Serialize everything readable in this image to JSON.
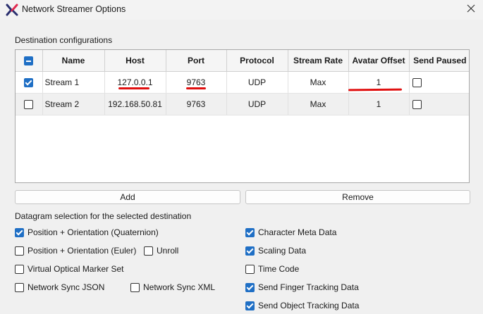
{
  "window": {
    "title": "Network Streamer Options",
    "icon": "x-logo-icon",
    "close_icon": "close-icon"
  },
  "destinations": {
    "label": "Destination configurations",
    "select_all_state": "partial",
    "columns": [
      "Name",
      "Host",
      "Port",
      "Protocol",
      "Stream Rate",
      "Avatar Offset",
      "Send Paused"
    ],
    "rows": [
      {
        "selected": true,
        "name": "Stream 1",
        "host": "127.0.0.1",
        "port": "9763",
        "protocol": "UDP",
        "rate": "Max",
        "offset": "1",
        "send_paused": false
      },
      {
        "selected": false,
        "name": "Stream 2",
        "host": "192.168.50.81",
        "port": "9763",
        "protocol": "UDP",
        "rate": "Max",
        "offset": "1",
        "send_paused": false
      }
    ]
  },
  "buttons": {
    "add": "Add",
    "remove": "Remove"
  },
  "datagram": {
    "label": "Datagram selection for the selected destination",
    "options": {
      "pos_quat": {
        "label": "Position + Orientation (Quaternion)",
        "checked": true
      },
      "pos_euler": {
        "label": "Position + Orientation (Euler)",
        "checked": false
      },
      "unroll": {
        "label": "Unroll",
        "checked": false
      },
      "virtual_marker": {
        "label": "Virtual Optical Marker Set",
        "checked": false
      },
      "sync_json": {
        "label": "Network Sync JSON",
        "checked": false
      },
      "sync_xml": {
        "label": "Network Sync XML",
        "checked": false
      },
      "char_meta": {
        "label": "Character Meta Data",
        "checked": true
      },
      "scaling": {
        "label": "Scaling Data",
        "checked": true
      },
      "timecode": {
        "label": "Time Code",
        "checked": false
      },
      "finger": {
        "label": "Send Finger Tracking Data",
        "checked": true
      },
      "object": {
        "label": "Send Object Tracking Data",
        "checked": true
      }
    }
  },
  "colors": {
    "accent": "#1f6fc5",
    "annotation": "#e01010",
    "logo_dark": "#2a2f6e",
    "logo_accent": "#e0294f"
  }
}
